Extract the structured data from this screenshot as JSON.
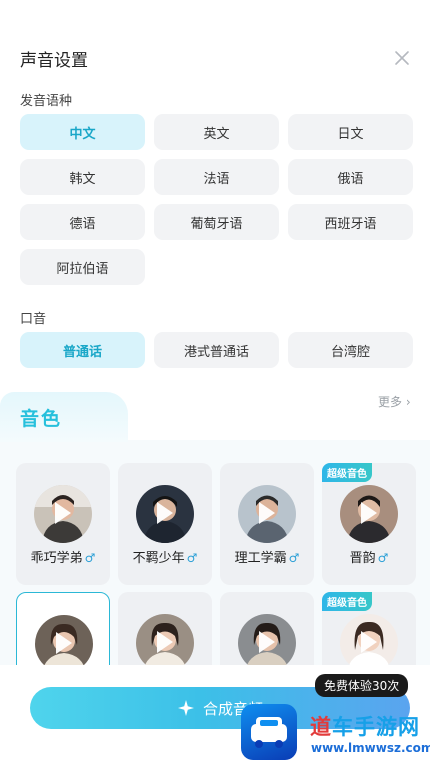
{
  "header": {
    "title": "声音设置"
  },
  "language": {
    "label": "发音语种",
    "options": [
      "中文",
      "英文",
      "日文",
      "韩文",
      "法语",
      "俄语",
      "德语",
      "葡萄牙语",
      "西班牙语",
      "阿拉伯语"
    ],
    "selected": "中文"
  },
  "accent": {
    "label": "口音",
    "options": [
      "普通话",
      "港式普通话",
      "台湾腔"
    ],
    "selected": "普通话"
  },
  "voice": {
    "tab_label": "音色",
    "more_label": "更多 ›",
    "male_symbol": "♂",
    "cards": [
      {
        "name": "乖巧学弟",
        "male": true,
        "badge": ""
      },
      {
        "name": "不羁少年",
        "male": true,
        "badge": ""
      },
      {
        "name": "理工学霸",
        "male": true,
        "badge": ""
      },
      {
        "name": "晋韵",
        "male": true,
        "badge": "超级音色"
      },
      {
        "name": "",
        "male": false,
        "badge": ""
      },
      {
        "name": "",
        "male": false,
        "badge": ""
      },
      {
        "name": "",
        "male": false,
        "badge": ""
      },
      {
        "name": "",
        "male": false,
        "badge": "超级音色"
      }
    ]
  },
  "footer": {
    "synth_label": "合成音频",
    "trial_badge": "免费体验30次"
  },
  "watermark": {
    "title_a": "道",
    "title_b": "车手游网",
    "url": "www.lmwwsz.com"
  },
  "colors": {
    "accent": "#26c0dc",
    "selected_bg": "#d8f3fb",
    "pill_bg": "#f2f3f5"
  }
}
